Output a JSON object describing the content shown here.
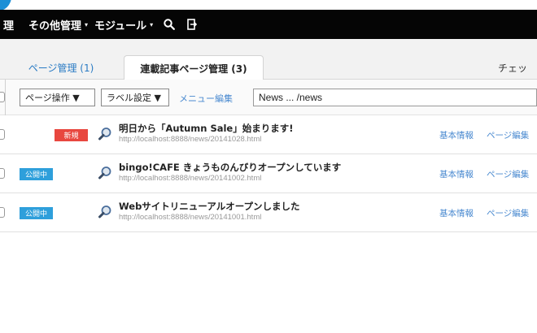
{
  "navbar": {
    "cut_label": "理",
    "other_manage": "その他管理",
    "module": "モジュール",
    "caret": "▾",
    "icons": [
      "search-icon",
      "exit-icon"
    ]
  },
  "tabs": {
    "inactive": "ページ管理 (1)",
    "active": "連載記事ページ管理 (3)",
    "right_cut": "チェッ"
  },
  "toolbar": {
    "page_op": "ページ操作 ▼",
    "label_setting": "ラベル設定 ▼",
    "menu_edit": "メニュー編集",
    "search_value": "News ... /news"
  },
  "rows": [
    {
      "badge": "新規",
      "badge_type": "new",
      "title": "明日から「Autumn Sale」始まります!",
      "url": "http://localhost:8888/news/20141028.html",
      "link_info": "基本情報",
      "link_edit": "ページ編集"
    },
    {
      "badge": "公開中",
      "badge_type": "public",
      "title": "bingo!CAFE きょうものんびりオープンしています",
      "url": "http://localhost:8888/news/20141002.html",
      "link_info": "基本情報",
      "link_edit": "ページ編集"
    },
    {
      "badge": "公開中",
      "badge_type": "public",
      "title": "Webサイトリニューアルオープンしました",
      "url": "http://localhost:8888/news/20141001.html",
      "link_info": "基本情報",
      "link_edit": "ページ編集"
    }
  ],
  "colors": {
    "navbar_bg": "#050505",
    "badge_new": "#e8473f",
    "badge_public": "#2e9fdb",
    "link": "#4a8ad0",
    "accent_circle": "#1c8fd6"
  }
}
